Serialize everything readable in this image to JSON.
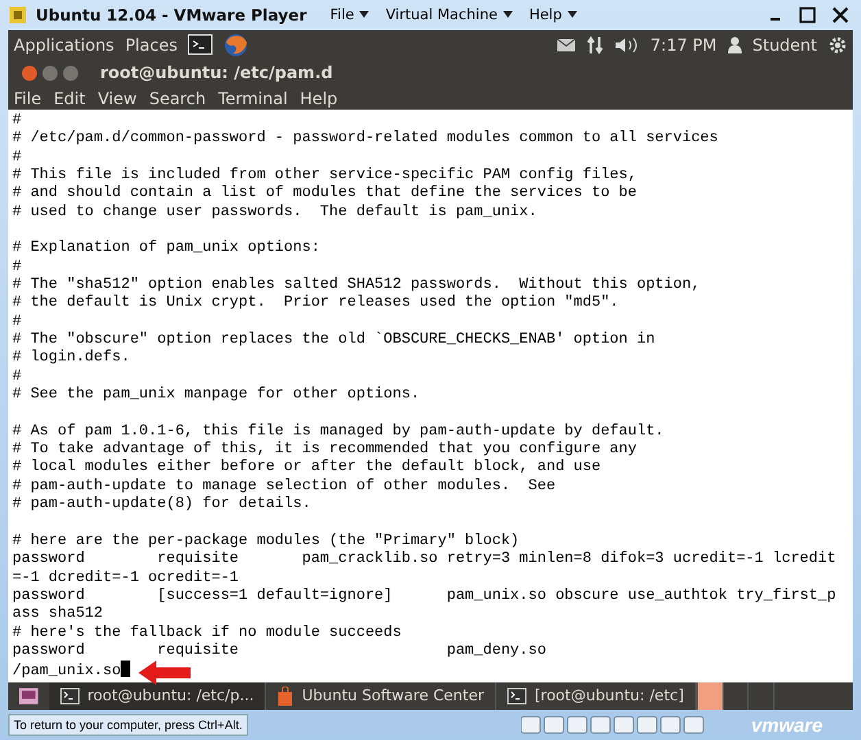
{
  "vm_window": {
    "title": "Ubuntu 12.04 - VMware Player",
    "menus": [
      "File",
      "Virtual Machine",
      "Help"
    ]
  },
  "top_panel": {
    "menus": [
      "Applications",
      "Places"
    ],
    "clock": "7:17 PM",
    "user": "Student"
  },
  "terminal": {
    "title": "root@ubuntu: /etc/pam.d",
    "menus": [
      "File",
      "Edit",
      "View",
      "Search",
      "Terminal",
      "Help"
    ],
    "lines": [
      {
        "kind": "text",
        "text": "#"
      },
      {
        "kind": "text",
        "text": "# /etc/pam.d/common-password - password-related modules common to all services"
      },
      {
        "kind": "text",
        "text": "#"
      },
      {
        "kind": "text",
        "text": "# This file is included from other service-specific PAM config files,"
      },
      {
        "kind": "text",
        "text": "# and should contain a list of modules that define the services to be"
      },
      {
        "kind": "text",
        "text": "# used to change user passwords.  The default is pam_unix."
      },
      {
        "kind": "blank"
      },
      {
        "kind": "text",
        "text": "# Explanation of pam_unix options:"
      },
      {
        "kind": "text",
        "text": "#"
      },
      {
        "kind": "text",
        "text": "# The \"sha512\" option enables salted SHA512 passwords.  Without this option,"
      },
      {
        "kind": "text",
        "text": "# the default is Unix crypt.  Prior releases used the option \"md5\"."
      },
      {
        "kind": "text",
        "text": "#"
      },
      {
        "kind": "text",
        "text": "# The \"obscure\" option replaces the old `OBSCURE_CHECKS_ENAB' option in"
      },
      {
        "kind": "text",
        "text": "# login.defs."
      },
      {
        "kind": "text",
        "text": "#"
      },
      {
        "kind": "text",
        "text": "# See the pam_unix manpage for other options."
      },
      {
        "kind": "blank"
      },
      {
        "kind": "text",
        "text": "# As of pam 1.0.1-6, this file is managed by pam-auth-update by default."
      },
      {
        "kind": "text",
        "text": "# To take advantage of this, it is recommended that you configure any"
      },
      {
        "kind": "text",
        "text": "# local modules either before or after the default block, and use"
      },
      {
        "kind": "text",
        "text": "# pam-auth-update to manage selection of other modules.  See"
      },
      {
        "kind": "text",
        "text": "# pam-auth-update(8) for details."
      },
      {
        "kind": "blank"
      },
      {
        "kind": "text",
        "text": "# here are the per-package modules (the \"Primary\" block)"
      },
      {
        "kind": "text",
        "text": "password        requisite       pam_cracklib.so retry=3 minlen=8 difok=3 ucredit=-1 lcredit"
      },
      {
        "kind": "text",
        "text": "=-1 dcredit=-1 ocredit=-1"
      },
      {
        "kind": "text",
        "text": "password        [success=1 default=ignore]      pam_unix.so obscure use_authtok try_first_p"
      },
      {
        "kind": "text",
        "text": "ass sha512"
      },
      {
        "kind": "text",
        "text": "# here's the fallback if no module succeeds"
      },
      {
        "kind": "text",
        "text": "password        requisite                       pam_deny.so"
      },
      {
        "kind": "prompt",
        "text": "/pam_unix.so"
      }
    ]
  },
  "taskbar": {
    "tasks": [
      {
        "label": "root@ubuntu: /etc/p...",
        "kind": "terminal",
        "selected": true
      },
      {
        "label": "Ubuntu Software Center",
        "kind": "app",
        "selected": false
      },
      {
        "label": "[root@ubuntu: /etc]",
        "kind": "terminal",
        "selected": false
      }
    ],
    "workspaces": [
      {
        "selected": true
      },
      {
        "selected": false
      },
      {
        "selected": false
      },
      {
        "selected": false
      }
    ]
  },
  "status_bar": {
    "hint": "To return to your computer, press Ctrl+Alt.",
    "logo": "vmware"
  }
}
